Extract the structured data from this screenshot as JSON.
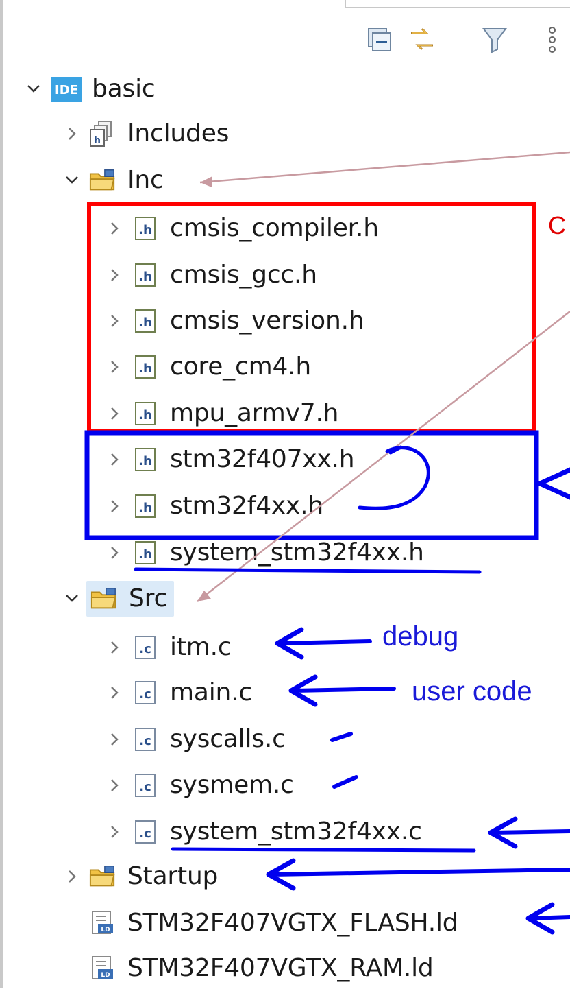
{
  "colors": {
    "accent_red": "#ff0000",
    "accent_blue": "#0000ee",
    "arrow_pink": "#c89aa0",
    "selection_bg": "#dbeaf8",
    "folder_yellow": "#f1c245",
    "ide_badge": "#3aa3e3"
  },
  "toolbar": {
    "buttons": [
      {
        "icon": "collapse-all-icon"
      },
      {
        "icon": "link-with-editor-icon"
      },
      {
        "icon": "filter-icon"
      },
      {
        "icon": "view-menu-icon"
      }
    ]
  },
  "tree": {
    "project": {
      "label": "basic",
      "badge": "IDE",
      "expanded": true
    },
    "includes": {
      "label": "Includes"
    },
    "inc": {
      "label": "Inc",
      "expanded": true,
      "files": [
        {
          "label": "cmsis_compiler.h",
          "ext": ".h"
        },
        {
          "label": "cmsis_gcc.h",
          "ext": ".h"
        },
        {
          "label": "cmsis_version.h",
          "ext": ".h"
        },
        {
          "label": "core_cm4.h",
          "ext": ".h"
        },
        {
          "label": "mpu_armv7.h",
          "ext": ".h"
        },
        {
          "label": "stm32f407xx.h",
          "ext": ".h"
        },
        {
          "label": "stm32f4xx.h",
          "ext": ".h"
        },
        {
          "label": "system_stm32f4xx.h",
          "ext": ".h"
        }
      ]
    },
    "src": {
      "label": "Src",
      "expanded": true,
      "files": [
        {
          "label": "itm.c",
          "ext": ".c"
        },
        {
          "label": "main.c",
          "ext": ".c"
        },
        {
          "label": "syscalls.c",
          "ext": ".c"
        },
        {
          "label": "sysmem.c",
          "ext": ".c"
        },
        {
          "label": "system_stm32f4xx.c",
          "ext": ".c"
        }
      ]
    },
    "startup": {
      "label": "Startup",
      "expanded": false
    },
    "linker_scripts": [
      {
        "label": "STM32F407VGTX_FLASH.ld"
      },
      {
        "label": "STM32F407VGTX_RAM.ld"
      }
    ]
  },
  "annotations": {
    "red_text": "C",
    "debug": "debug",
    "user_code": "user code"
  }
}
